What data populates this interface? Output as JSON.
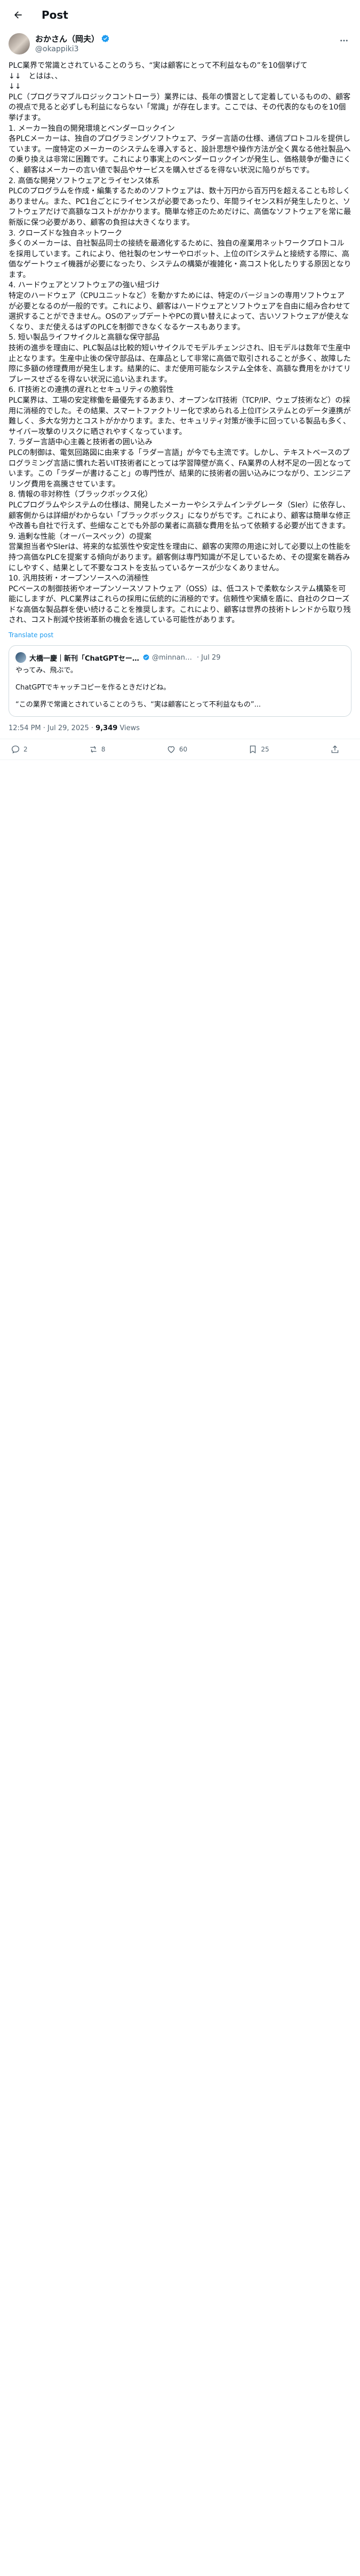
{
  "header": {
    "back_icon": "arrow-left-icon",
    "title": "Post"
  },
  "author": {
    "display_name": "おかさん（岡夫）",
    "handle": "@okappiki3",
    "verified_color": "#1d9bf0"
  },
  "post": {
    "paragraphs": [
      "PLC業界で常識とされていることのうち、“実は顧客にとって不利益なもの”を10個挙げて",
      "↓↓　とはは、、",
      "↓↓",
      "PLC（プログラマブルロジックコントローラ）業界には、長年の慣習として定着しているものの、顧客の視点で見ると必ずしも利益にならない「常識」が存在します。ここでは、その代表的なものを10個挙げます。",
      "1. メーカー独自の開発環境とベンダーロックイン",
      "各PLCメーカーは、独自のプログラミングソフトウェア、ラダー言語の仕様、通信プロトコルを提供しています。一度特定のメーカーのシステムを導入すると、設計思想や操作方法が全く異なる他社製品への乗り換えは非常に困難です。これにより事実上のベンダーロックインが発生し、価格競争が働きにくく、顧客はメーカーの言い値で製品やサービスを購入せざるを得ない状況に陥りがちです。",
      "2. 高価な開発ソフトウェアとライセンス体系",
      "PLCのプログラムを作成・編集するためのソフトウェアは、数十万円から百万円を超えることも珍しくありません。また、PC1台ごとにライセンスが必要であったり、年間ライセンス料が発生したりと、ソフトウェアだけで高額なコストがかかります。簡単な修正のためだけに、高価なソフトウェアを常に最新版に保つ必要があり、顧客の負担は大きくなります。",
      "3. クローズドな独自ネットワーク",
      "多くのメーカーは、自社製品同士の接続を最適化するために、独自の産業用ネットワークプロトコルを採用しています。これにより、他社製のセンサーやロボット、上位のITシステムと接続する際に、高価なゲートウェイ機器が必要になったり、システムの構築が複雑化・高コスト化したりする原因となります。",
      "4. ハードウェアとソフトウェアの強い紐づけ",
      "特定のハードウェア（CPUユニットなど）を動かすためには、特定のバージョンの専用ソフトウェアが必要となるのが一般的です。これにより、顧客はハードウェアとソフトウェアを自由に組み合わせて選択することができません。OSのアップデートやPCの買い替えによって、古いソフトウェアが使えなくなり、まだ使えるはずのPLCを制御できなくなるケースもあります。",
      "5. 短い製品ライフサイクルと高額な保守部品",
      "技術の進歩を理由に、PLC製品は比較的短いサイクルでモデルチェンジされ、旧モデルは数年で生産中止となります。生産中止後の保守部品は、在庫品として非常に高価で取引されることが多く、故障した際に多額の修理費用が発生します。結果的に、まだ使用可能なシステム全体を、高額な費用をかけてリプレースせざるを得ない状況に追い込まれます。",
      "6. IT技術との連携の遅れとセキュリティの脆弱性",
      "PLC業界は、工場の安定稼働を最優先するあまり、オープンなIT技術（TCP/IP、ウェブ技術など）の採用に消極的でした。その結果、スマートファクトリー化で求められる上位ITシステムとのデータ連携が難しく、多大な労力とコストがかかります。また、セキュリティ対策が後手に回っている製品も多く、サイバー攻撃のリスクに晒されやすくなっています。",
      "7. ラダー言語中心主義と技術者の囲い込み",
      "PLCの制御は、電気回路図に由来する「ラダー言語」が今でも主流です。しかし、テキストベースのプログラミング言語に慣れた若いIT技術者にとっては学習障壁が高く、FA業界の人材不足の一因となっています。この「ラダーが書けること」の専門性が、結果的に技術者の囲い込みにつながり、エンジニアリング費用を高騰させています。",
      "8. 情報の非対称性（ブラックボックス化）",
      "PLCプログラムやシステムの仕様は、開発したメーカーやシステムインテグレータ（SIer）に依存し、顧客側からは詳細がわからない「ブラックボックス」になりがちです。これにより、顧客は簡単な修正や改善も自社で行えず、些細なことでも外部の業者に高額な費用を払って依頼する必要が出てきます。",
      "9. 過剰な性能（オーバースペック）の提案",
      "営業担当者やSIerは、将来的な拡張性や安定性を理由に、顧客の実際の用途に対して必要以上の性能を持つ高価なPLCを提案する傾向があります。顧客側は専門知識が不足しているため、その提案を鵜呑みにしやすく、結果として不要なコストを支払っているケースが少なくありません。",
      "10. 汎用技術・オープンソースへの消極性",
      "PCベースの制御技術やオープンソースソフトウェア（OSS）は、低コストで柔軟なシステム構築を可能にしますが、PLC業界はこれらの採用に伝統的に消極的です。信頼性や実績を盾に、自社のクローズドな高価な製品群を使い続けることを推奨します。これにより、顧客は世界の技術トレンドから取り残され、コスト削減や技術革新の機会を逃している可能性があります。"
    ],
    "translate_label": "Translate post",
    "timestamp": "12:54 PM · Jul 29, 2025 ·",
    "views_count": "9,349",
    "views_label": "Views"
  },
  "quote": {
    "name": "大橋一慶｜新刊「ChatGPTセールスコピー超入...",
    "handle": "@minnano...",
    "date": "Jul 29",
    "lines": [
      "やってみ、飛ぶで。",
      "ChatGPTでキャッチコピーを作るときだけどね。",
      "“この業界で常識とされていることのうち、“実は顧客にとって不利益なもの”..."
    ]
  },
  "actions": {
    "replies": "2",
    "reposts": "8",
    "likes": "60",
    "bookmarks": "25"
  }
}
